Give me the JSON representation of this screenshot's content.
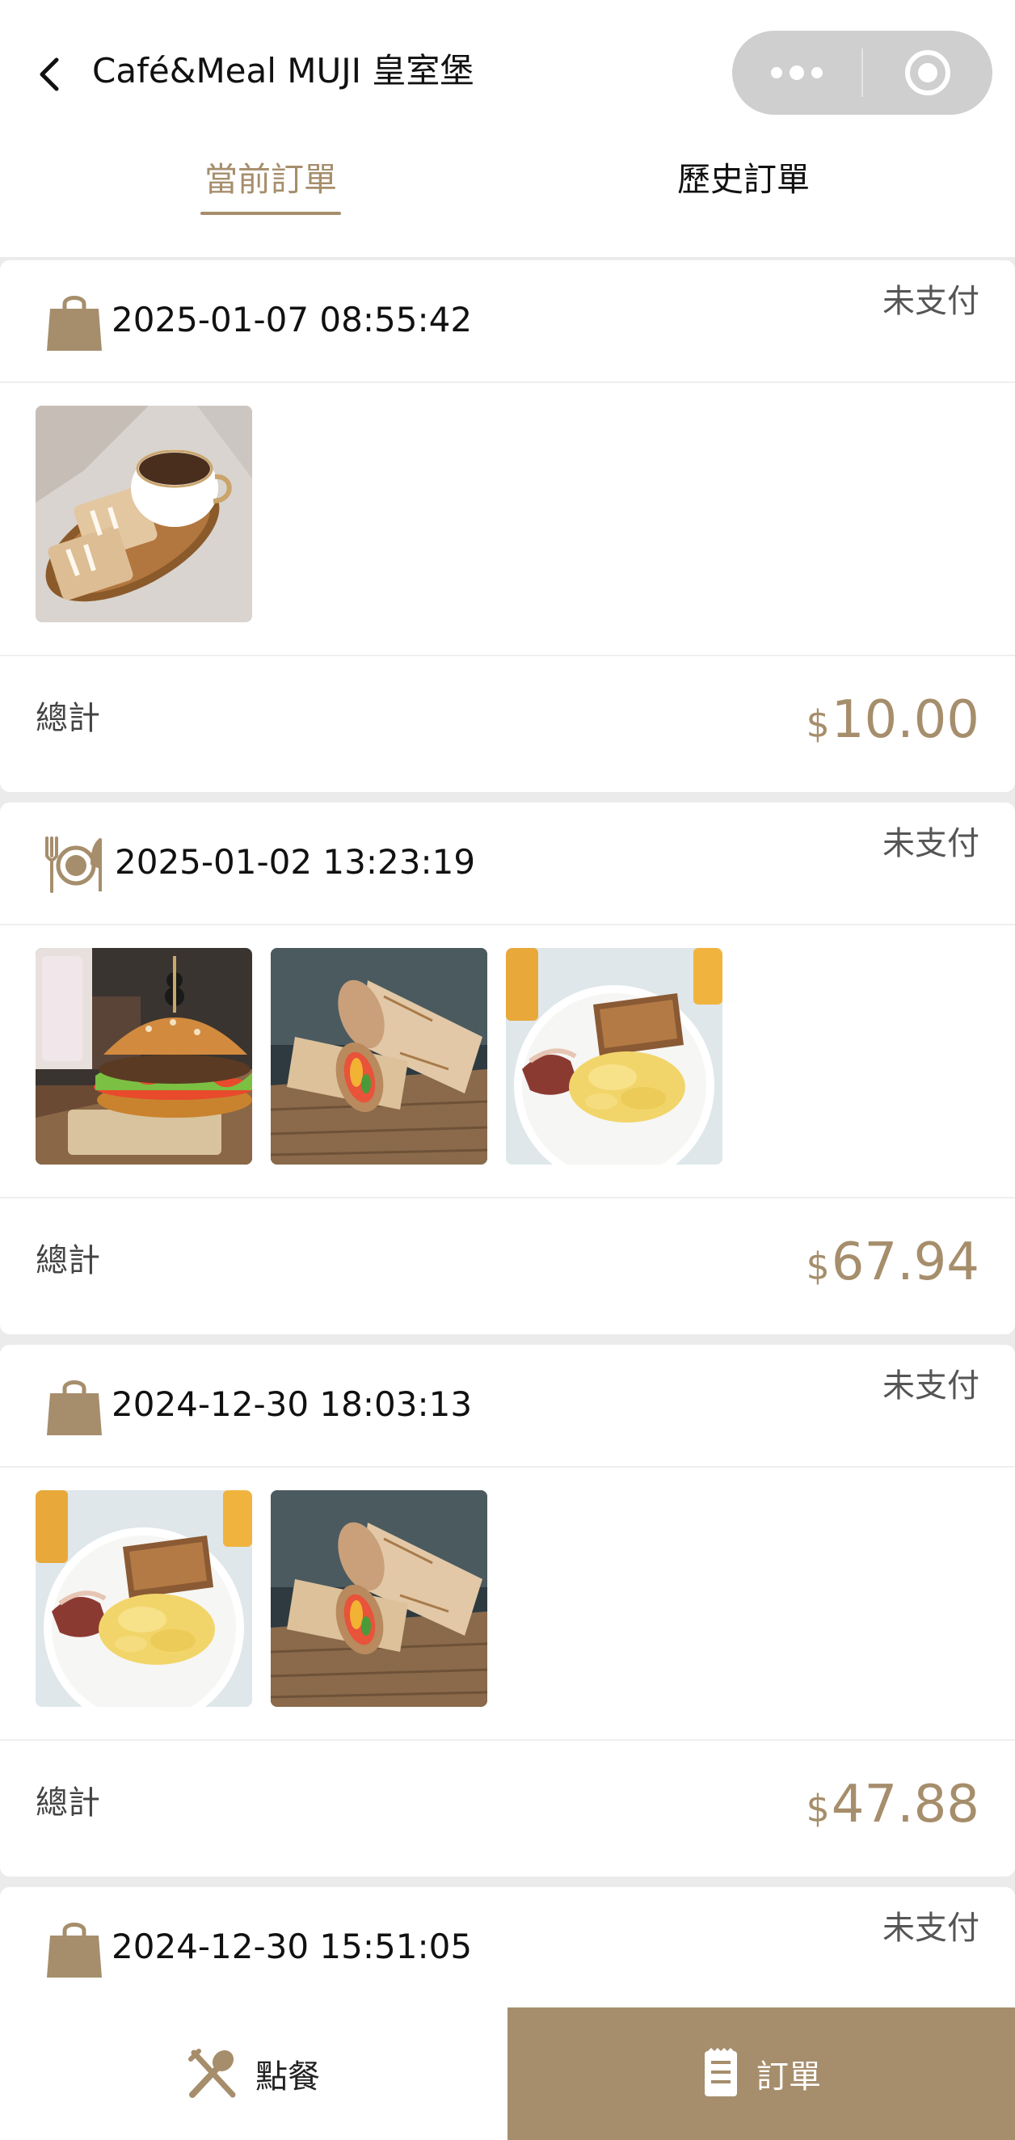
{
  "header": {
    "title": "Café&Meal MUJI 皇室堡",
    "tabs": {
      "current": "當前訂單",
      "history": "歷史訂單"
    }
  },
  "colors": {
    "accent": "#a68e6c",
    "capsule": "#cfcfcf",
    "background": "#ebebeb"
  },
  "orders": [
    {
      "type_icon": "shopping-bag-icon",
      "time": "2025-01-07 08:55:42",
      "status": "未支付",
      "total_label": "總計",
      "currency": "$",
      "total": "10.00",
      "items": [
        "coffee-and-toast-image"
      ]
    },
    {
      "type_icon": "dine-in-plate-icon",
      "time": "2025-01-02 13:23:19",
      "status": "未支付",
      "total_label": "總計",
      "currency": "$",
      "total": "67.94",
      "items": [
        "burger-image",
        "wrap-image",
        "breakfast-plate-image"
      ]
    },
    {
      "type_icon": "shopping-bag-icon",
      "time": "2024-12-30 18:03:13",
      "status": "未支付",
      "total_label": "總計",
      "currency": "$",
      "total": "47.88",
      "items": [
        "breakfast-plate-image",
        "wrap-image"
      ]
    },
    {
      "type_icon": "shopping-bag-icon",
      "time": "2024-12-30 15:51:05",
      "status": "未支付"
    }
  ],
  "tabbar": {
    "menu_label": "點餐",
    "orders_label": "訂單"
  }
}
